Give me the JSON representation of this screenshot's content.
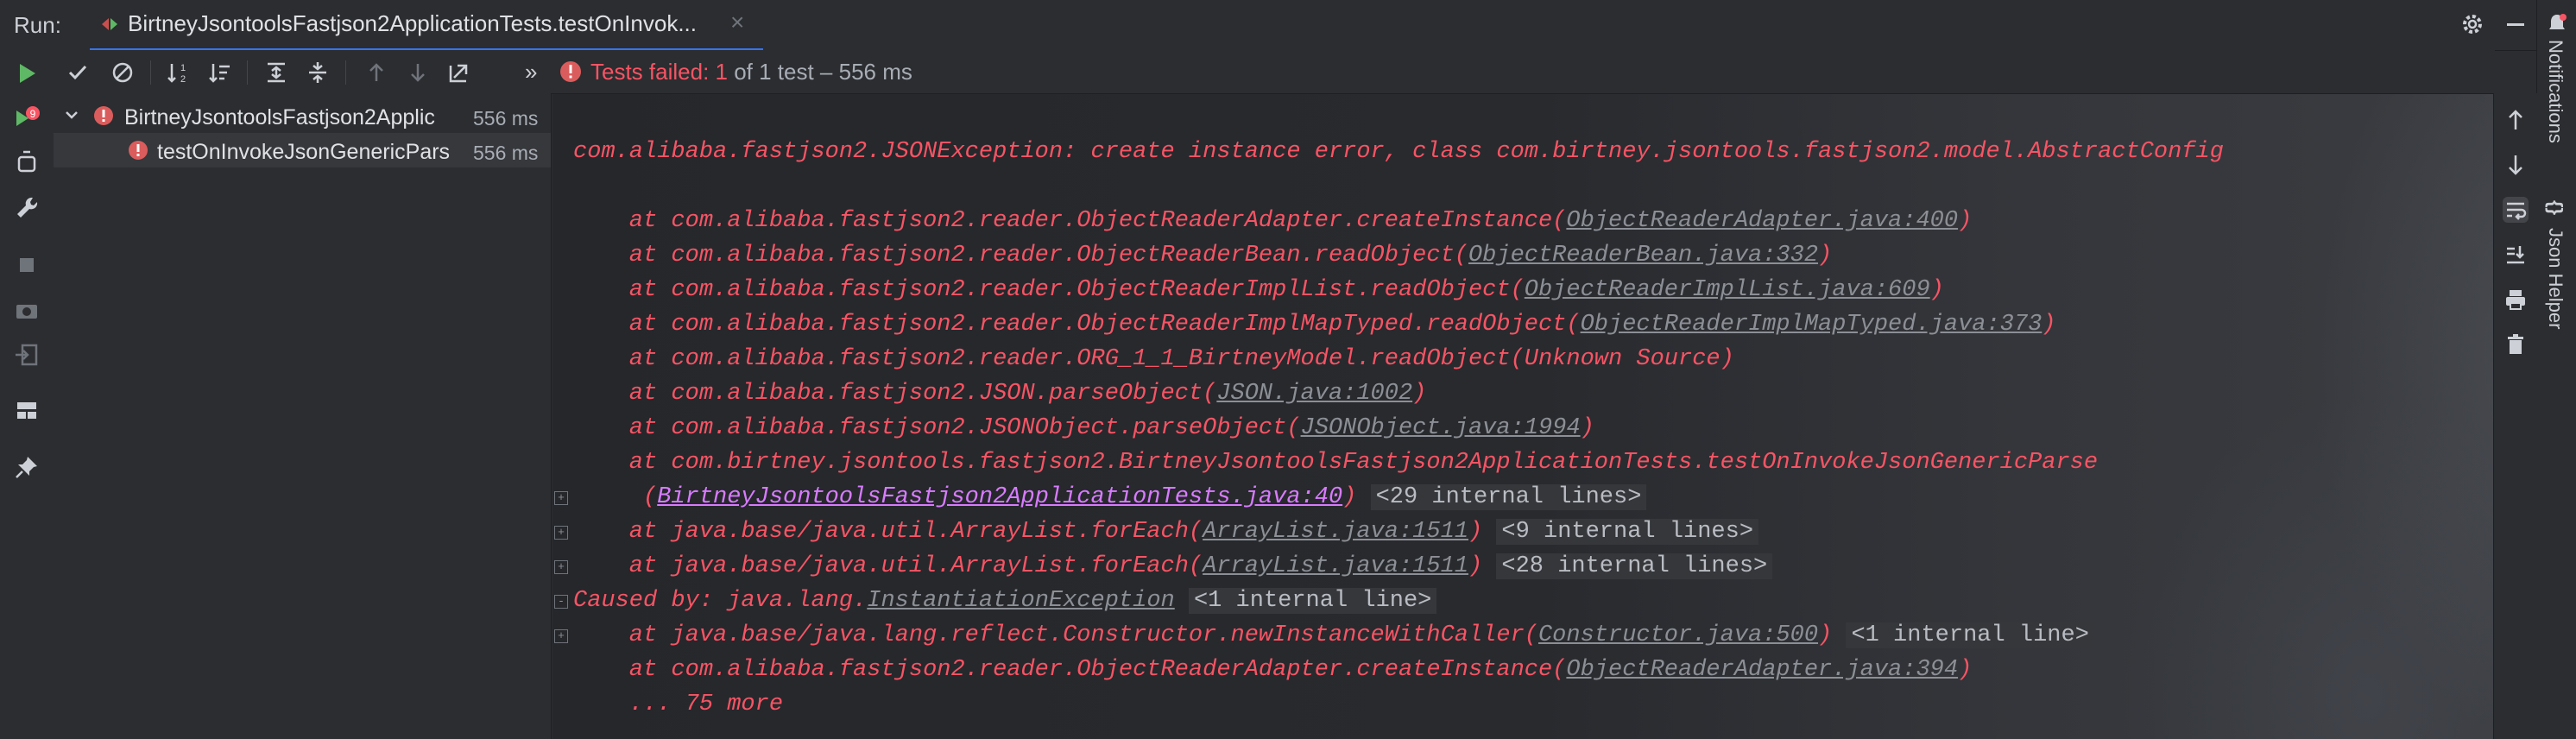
{
  "run_panel": {
    "label": "Run:",
    "tab_title": "BirtneyJsontoolsFastjson2ApplicationTests.testOnInvok...",
    "tab_close": "×"
  },
  "status": {
    "failed_text": "Tests failed: 1",
    "rest_text": " of 1 test – 556 ms",
    "more_chevron": "»"
  },
  "tree": [
    {
      "name": "BirtneyJsontoolsFastjson2Applic",
      "duration": "556 ms"
    },
    {
      "name": "testOnInvokeJsonGenericPars",
      "duration": "556 ms"
    }
  ],
  "console": {
    "exception": "com.alibaba.fastjson2.JSONException: create instance error, class com.birtney.jsontools.fastjson2.model.AbstractConfig",
    "lines": [
      {
        "pre": "    at com.alibaba.fastjson2.reader.ObjectReaderAdapter.createInstance(",
        "link": "ObjectReaderAdapter.java:400",
        "post": ")"
      },
      {
        "pre": "    at com.alibaba.fastjson2.reader.ObjectReaderBean.readObject(",
        "link": "ObjectReaderBean.java:332",
        "post": ")"
      },
      {
        "pre": "    at com.alibaba.fastjson2.reader.ObjectReaderImplList.readObject(",
        "link": "ObjectReaderImplList.java:609",
        "post": ")"
      },
      {
        "pre": "    at com.alibaba.fastjson2.reader.ObjectReaderImplMapTyped.readObject(",
        "link": "ObjectReaderImplMapTyped.java:373",
        "post": ")"
      },
      {
        "pre": "    at com.alibaba.fastjson2.reader.ORG_1_1_BirtneyModel.readObject(Unknown Source)"
      },
      {
        "pre": "    at com.alibaba.fastjson2.JSON.parseObject(",
        "link": "JSON.java:1002",
        "post": ")"
      },
      {
        "pre": "    at com.alibaba.fastjson2.JSONObject.parseObject(",
        "link": "JSONObject.java:1994",
        "post": ")"
      },
      {
        "pre": "    at com.birtney.jsontools.fastjson2.BirtneyJsontoolsFastjson2ApplicationTests.testOnInvokeJsonGenericParse"
      },
      {
        "pre": "     (",
        "link": "BirtneyJsontoolsFastjson2ApplicationTests.java:40",
        "post": ")",
        "internal": "<29 internal lines>",
        "fold": "+",
        "magenta": true
      },
      {
        "pre": "    at java.base/java.util.ArrayList.forEach(",
        "link": "ArrayList.java:1511",
        "post": ")",
        "internal": "<9 internal lines>",
        "fold": "+"
      },
      {
        "pre": "    at java.base/java.util.ArrayList.forEach(",
        "link": "ArrayList.java:1511",
        "post": ")",
        "internal": "<28 internal lines>",
        "fold": "+"
      },
      {
        "pre": "Caused by: java.lang.",
        "link": "InstantiationException",
        "post": "",
        "internal": "<1 internal line>",
        "fold": "-"
      },
      {
        "pre": "    at java.base/java.lang.reflect.Constructor.newInstanceWithCaller(",
        "link": "Constructor.java:500",
        "post": ")",
        "internal": "<1 internal line>",
        "fold": "+"
      },
      {
        "pre": "    at com.alibaba.fastjson2.reader.ObjectReaderAdapter.createInstance(",
        "link": "ObjectReaderAdapter.java:394",
        "post": ")"
      },
      {
        "pre": "    ... 75 more"
      }
    ]
  },
  "side_labels": {
    "notifications": "Notifications",
    "json_helper": "Json Helper",
    "json_helper_glyph": "{}"
  },
  "colors": {
    "error": "#f75464",
    "link": "#8c8f95",
    "accent": "#3574f0",
    "run_green": "#5fb865"
  }
}
